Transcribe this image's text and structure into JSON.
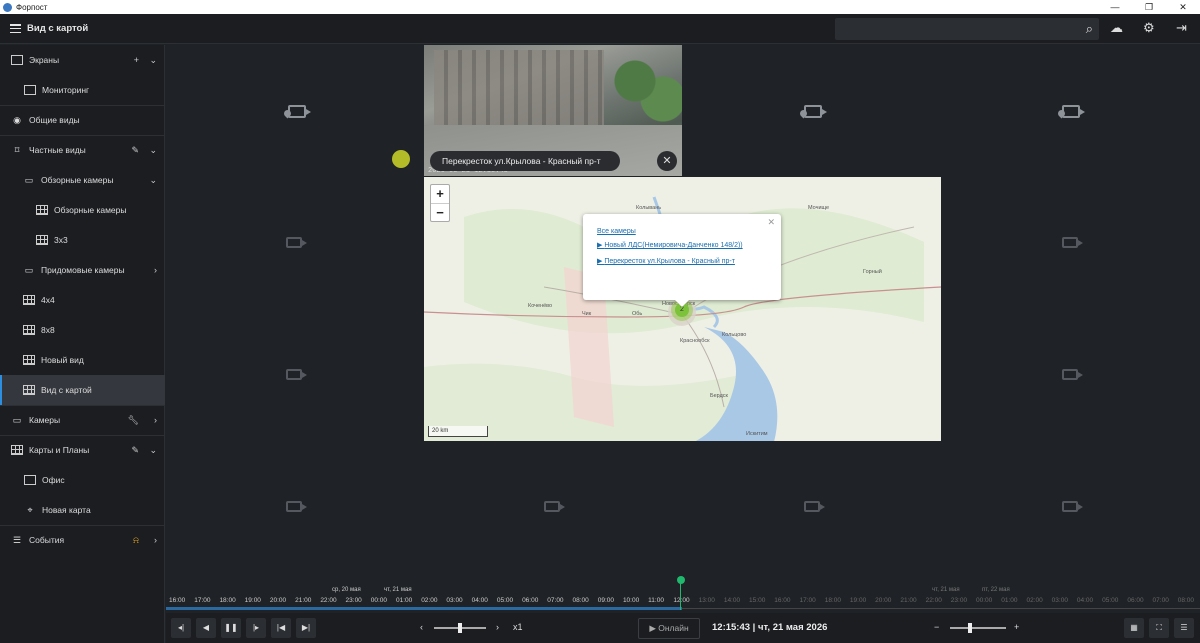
{
  "window": {
    "title": "Форпост",
    "controls": [
      "—",
      "❐",
      "✕"
    ]
  },
  "header": {
    "view_title": "Вид с картой",
    "search_placeholder": ""
  },
  "sidebar": {
    "screens": {
      "label": "Экраны",
      "items": [
        "Мониторинг"
      ]
    },
    "common_views": "Общие виды",
    "private_views": {
      "label": "Частные виды",
      "overview_folder": "Обзорные камеры",
      "overview_items": [
        "Обзорные камеры",
        "3x3"
      ],
      "yard_folder": "Придомовые камеры",
      "items": [
        "4x4",
        "8x8",
        "Новый вид",
        "Вид с картой"
      ]
    },
    "cameras": "Камеры",
    "maps": {
      "label": "Карты и Планы",
      "items": [
        "Офис",
        "Новая карта"
      ]
    },
    "events": "События"
  },
  "video": {
    "camera_name": "Перекресток ул.Крылова - Красный пр-т",
    "timestamp": "2026-05-21 12:15:43"
  },
  "map": {
    "zoom_in": "+",
    "zoom_out": "−",
    "scale": "20 km",
    "popup": {
      "all_cameras": "Все камеры",
      "cameras": [
        "Новый ЛДС(Немировича-Данченко 148/2))",
        "Перекресток ул.Крылова - Красный пр-т"
      ]
    },
    "cluster_count": "2",
    "labels": {
      "kolyvan": "Колывань",
      "mochishe": "Мочище",
      "gorny": "Горный",
      "kochenevo": "Коченёво",
      "chik": "Чик",
      "ob": "Обь",
      "novosibirsk": "Новосибирск",
      "krasnoobsk": "Краснообск",
      "koltsovo": "Кольцово",
      "berdsk": "Бердск",
      "iskitim": "Искитим"
    }
  },
  "timeline": {
    "date_left": "ср, 20 мая",
    "date_mid": "чт, 21 мая",
    "date_right1": "чт, 21 мая",
    "date_right2": "пт, 22 мая",
    "hours": [
      "16:00",
      "17:00",
      "18:00",
      "19:00",
      "20:00",
      "21:00",
      "22:00",
      "23:00",
      "00:00",
      "01:00",
      "02:00",
      "03:00",
      "04:00",
      "05:00",
      "06:00",
      "07:00",
      "08:00",
      "09:00",
      "10:00",
      "11:00",
      "12:00",
      "13:00",
      "14:00",
      "15:00",
      "16:00",
      "17:00",
      "18:00",
      "19:00",
      "20:00",
      "21:00",
      "22:00",
      "23:00",
      "00:00",
      "01:00",
      "02:00",
      "03:00",
      "04:00",
      "05:00",
      "06:00",
      "07:00",
      "08:00"
    ],
    "playback_position": 0.5
  },
  "controls": {
    "speed": "x1",
    "online_label": "Онлайн",
    "datetime": "12:15:43 | чт, 21 мая 2026",
    "speed_slider": 0.5,
    "zoom_slider": 0.35
  }
}
